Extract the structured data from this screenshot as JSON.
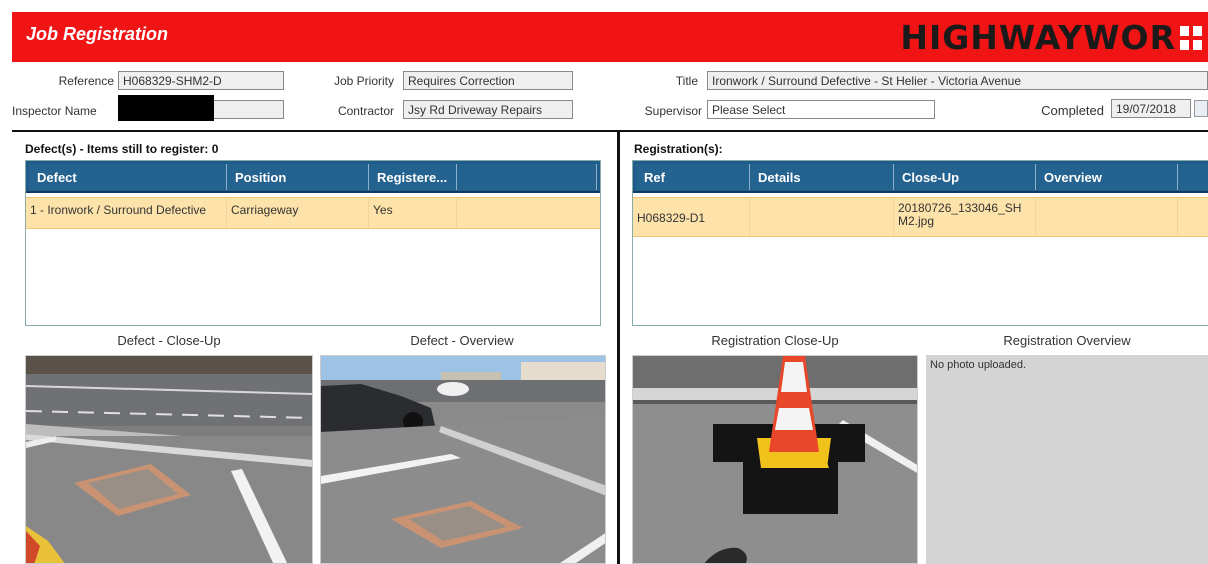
{
  "header": {
    "title": "Job Registration",
    "brand": "HIGHWAYWOR"
  },
  "form": {
    "reference_label": "Reference",
    "reference_value": "H068329-SHM2-D",
    "priority_label": "Job Priority",
    "priority_value": "Requires Correction",
    "title_label": "Title",
    "title_value": "Ironwork / Surround Defective - St Helier - Victoria Avenue",
    "inspector_label": "Inspector Name",
    "inspector_value": "",
    "contractor_label": "Contractor",
    "contractor_value": "Jsy Rd Driveway Repairs",
    "supervisor_label": "Supervisor",
    "supervisor_value": "Please Select",
    "completed_label": "Completed",
    "completed_value": "19/07/2018"
  },
  "defects": {
    "title": "Defect(s) - Items still to register: 0",
    "columns": [
      "Defect",
      "Position",
      "Registere..."
    ],
    "rows": [
      [
        "1 - Ironwork / Surround Defective",
        "Carriageway",
        "Yes"
      ]
    ],
    "closeup_caption": "Defect - Close-Up",
    "overview_caption": "Defect - Overview"
  },
  "registrations": {
    "title": "Registration(s):",
    "columns": [
      "Ref",
      "Details",
      "Close-Up",
      "Overview"
    ],
    "rows": [
      [
        "H068329-D1",
        "",
        "20180726_133046_SHM2.jpg",
        ""
      ]
    ],
    "closeup_caption": "Registration Close-Up",
    "overview_caption": "Registration Overview",
    "no_photo_text": "No photo uploaded."
  },
  "colors": {
    "header_red": "#f01414",
    "grid_header": "#1f5c8a",
    "row_highlight": "#fde3aa"
  }
}
